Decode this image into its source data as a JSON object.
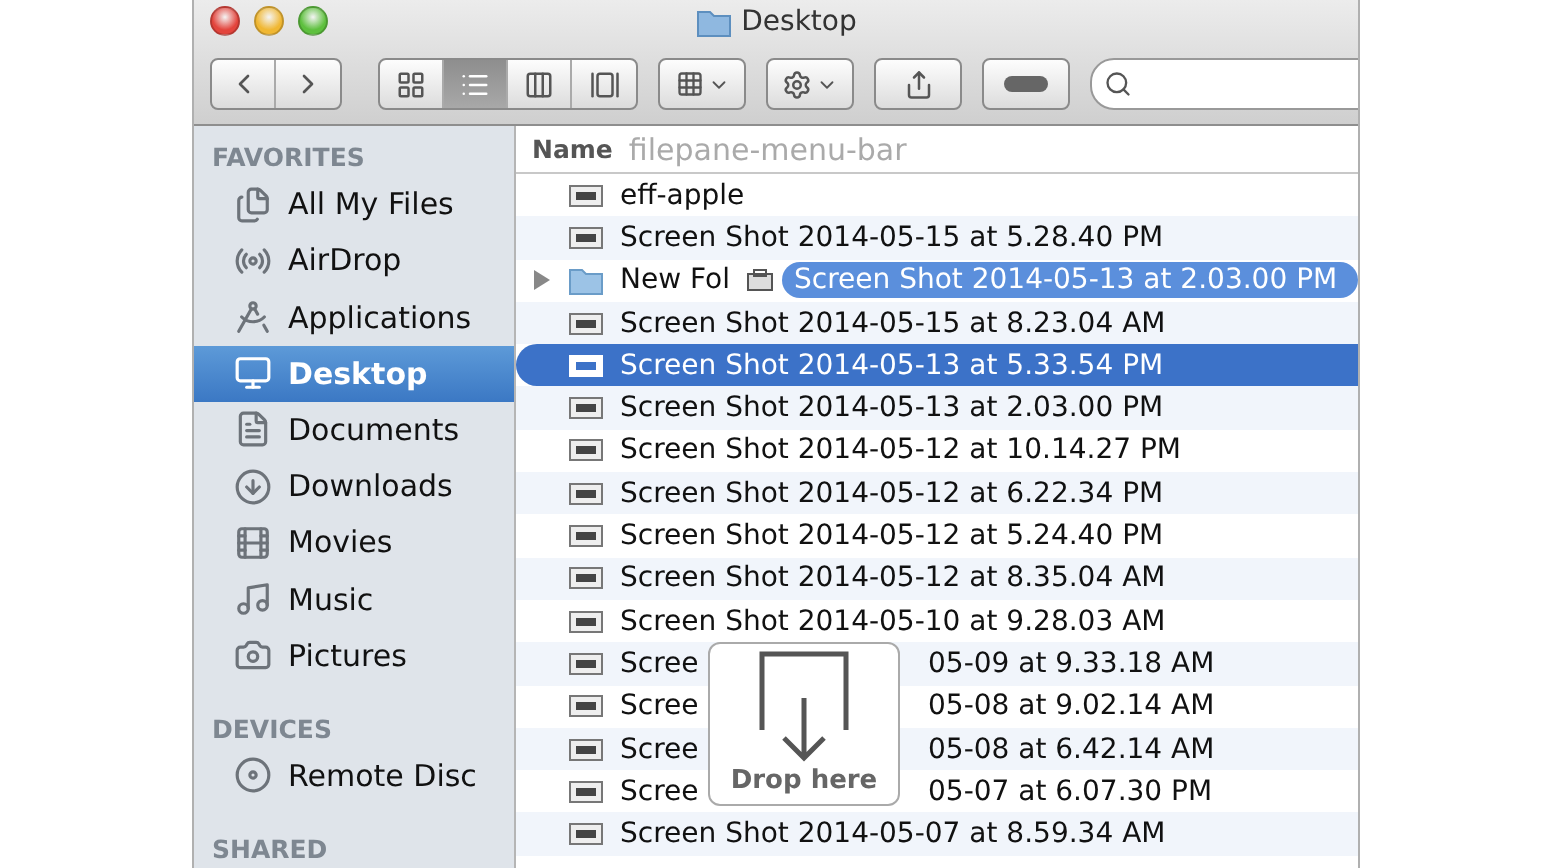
{
  "window": {
    "title": "Desktop"
  },
  "toolbar": {
    "view_buttons": [
      {
        "kind": "icons",
        "selected": false
      },
      {
        "kind": "list",
        "selected": true
      },
      {
        "kind": "columns",
        "selected": false
      },
      {
        "kind": "coverflow",
        "selected": false
      }
    ]
  },
  "sidebar": {
    "sections": [
      {
        "title": "FAVORITES",
        "items": [
          {
            "label": "All My Files",
            "kind": "files",
            "selected": false
          },
          {
            "label": "AirDrop",
            "kind": "airdrop",
            "selected": false
          },
          {
            "label": "Applications",
            "kind": "apps",
            "selected": false
          },
          {
            "label": "Desktop",
            "kind": "desktop",
            "selected": true
          },
          {
            "label": "Documents",
            "kind": "documents",
            "selected": false
          },
          {
            "label": "Downloads",
            "kind": "downloads",
            "selected": false
          },
          {
            "label": "Movies",
            "kind": "movies",
            "selected": false
          },
          {
            "label": "Music",
            "kind": "music",
            "selected": false
          },
          {
            "label": "Pictures",
            "kind": "pictures",
            "selected": false
          }
        ]
      },
      {
        "title": "DEVICES",
        "items": [
          {
            "label": "Remote Disc",
            "kind": "disc",
            "selected": false
          }
        ]
      },
      {
        "title": "SHARED"
      }
    ]
  },
  "file_list": {
    "column": "Name",
    "header_overlay_text": "filepane-menu-bar",
    "rows": [
      {
        "name": "eff-apple",
        "kind": "image",
        "selected": false
      },
      {
        "name": "Screen Shot 2014-05-15 at 5.28.40 PM",
        "kind": "image",
        "selected": false
      },
      {
        "name": "New Fol",
        "kind": "folder",
        "expanded": false,
        "selected": false
      },
      {
        "name": "Screen Shot 2014-05-15 at 8.23.04 AM",
        "kind": "image",
        "selected": false
      },
      {
        "name": "Screen Shot 2014-05-13 at 5.33.54 PM",
        "kind": "image",
        "selected": true
      },
      {
        "name": "Screen Shot 2014-05-13 at 2.03.00 PM",
        "kind": "image",
        "selected": false
      },
      {
        "name": "Screen Shot 2014-05-12 at 10.14.27 PM",
        "kind": "image",
        "selected": false
      },
      {
        "name": "Screen Shot 2014-05-12 at 6.22.34 PM",
        "kind": "image",
        "selected": false
      },
      {
        "name": "Screen Shot 2014-05-12 at 5.24.40 PM",
        "kind": "image",
        "selected": false
      },
      {
        "name": "Screen Shot 2014-05-12 at 8.35.04 AM",
        "kind": "image",
        "selected": false
      },
      {
        "name": "Screen Shot 2014-05-10 at 9.28.03 AM",
        "kind": "image",
        "selected": false
      },
      {
        "name": "Scree",
        "name_after_overlay": "05-09 at 9.33.18 AM",
        "kind": "image",
        "selected": false
      },
      {
        "name": "Scree",
        "name_after_overlay": "05-08 at 9.02.14 AM",
        "kind": "image",
        "selected": false
      },
      {
        "name": "Scree",
        "name_after_overlay": "05-08 at 6.42.14 AM",
        "kind": "image",
        "selected": false
      },
      {
        "name": "Scree",
        "name_after_overlay": "05-07 at 6.07.30 PM",
        "kind": "image",
        "selected": false
      },
      {
        "name": "Screen Shot 2014-05-07 at 8.59.34 AM",
        "kind": "image",
        "selected": false
      }
    ],
    "drag_item": {
      "label": "Screen Shot 2014-05-13 at 2.03.00 PM"
    },
    "drop_overlay": {
      "label": "Drop here"
    }
  }
}
